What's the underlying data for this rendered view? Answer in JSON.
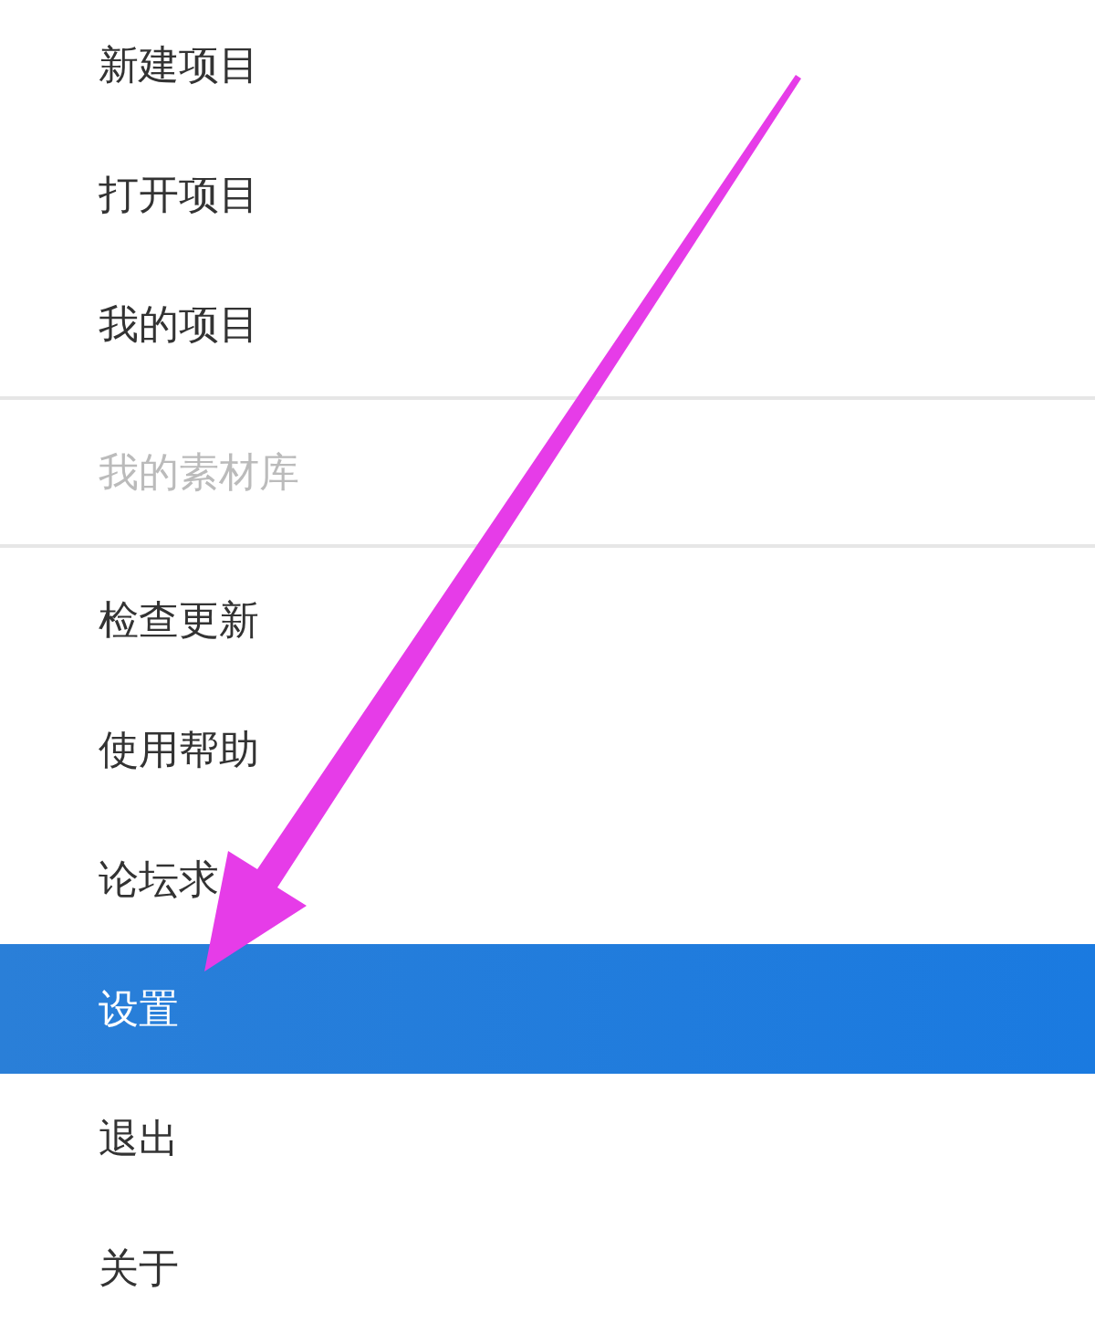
{
  "menu": {
    "items": [
      {
        "kind": "item",
        "label": "新建项目",
        "selected": false,
        "disabled": false
      },
      {
        "kind": "item",
        "label": "打开项目",
        "selected": false,
        "disabled": false
      },
      {
        "kind": "item",
        "label": "我的项目",
        "selected": false,
        "disabled": false
      },
      {
        "kind": "divider"
      },
      {
        "kind": "item",
        "label": "我的素材库",
        "selected": false,
        "disabled": true
      },
      {
        "kind": "divider"
      },
      {
        "kind": "item",
        "label": "检查更新",
        "selected": false,
        "disabled": false
      },
      {
        "kind": "item",
        "label": "使用帮助",
        "selected": false,
        "disabled": false
      },
      {
        "kind": "item",
        "label": "论坛求",
        "selected": false,
        "disabled": false
      },
      {
        "kind": "item",
        "label": "设置",
        "selected": true,
        "disabled": false
      },
      {
        "kind": "item",
        "label": "退出",
        "selected": false,
        "disabled": false
      },
      {
        "kind": "item",
        "label": "关于",
        "selected": false,
        "disabled": false
      }
    ]
  }
}
